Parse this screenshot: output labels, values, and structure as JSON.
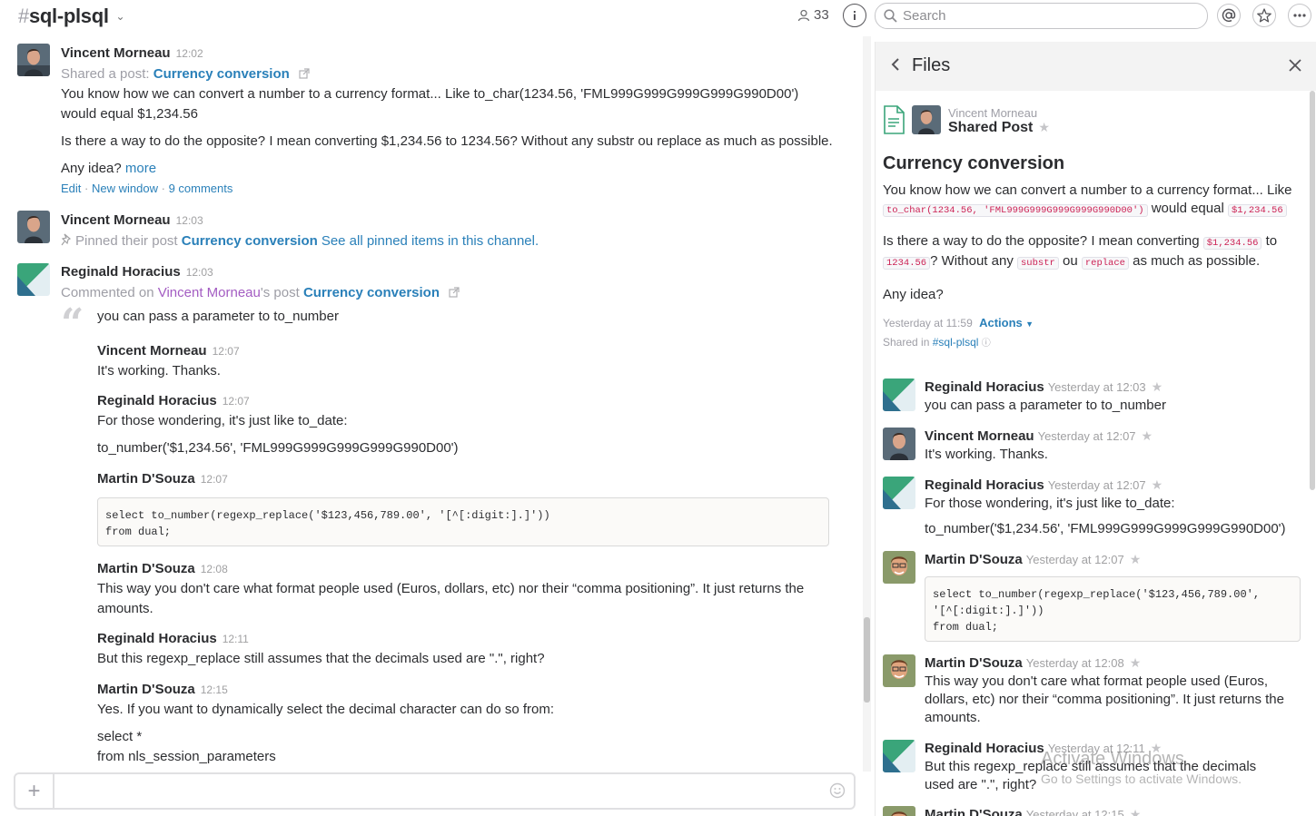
{
  "header": {
    "hash": "#",
    "channel": "sql-plsql",
    "member_count": "33",
    "search_placeholder": "Search"
  },
  "messages": {
    "m1": {
      "author": "Vincent Morneau",
      "time": "12:02",
      "shared_prefix": "Shared a post:",
      "post_title": "Currency conversion",
      "p1": "You know how we can convert a number to a currency format... Like to_char(1234.56, 'FML999G999G999G999G990D00') would equal $1,234.56",
      "p2": "Is there a way to do the opposite? I mean converting $1,234.56 to 1234.56? Without any substr ou replace as much as possible.",
      "p3": "Any idea?",
      "more": "more",
      "edit": "Edit",
      "new_window": "New window",
      "comments": "9 comments"
    },
    "m2": {
      "author": "Vincent Morneau",
      "time": "12:03",
      "pinned_prefix": "Pinned their post",
      "post_title": "Currency conversion",
      "see_all": "See all pinned items in this channel."
    },
    "m3": {
      "author": "Reginald Horacius",
      "time": "12:03",
      "commented_on": "Commented on",
      "owner": "Vincent Morneau",
      "owner_suffix": "'s post",
      "post_title": "Currency conversion",
      "quote": "you can pass a parameter to to_number"
    },
    "replies": [
      {
        "author": "Vincent Morneau",
        "time": "12:07",
        "text": "It's working. Thanks."
      },
      {
        "author": "Reginald Horacius",
        "time": "12:07",
        "text": "For those wondering, it's just like to_date:",
        "text2": "to_number('$1,234.56', 'FML999G999G999G999G990D00')"
      },
      {
        "author": "Martin D'Souza",
        "time": "12:07",
        "code1": "select to_number(regexp_replace('$123,456,789.00', '[^[:digit:].]'))",
        "code2": "from dual;"
      },
      {
        "author": "Martin D'Souza",
        "time": "12:08",
        "text": "This way you don't care what format people used (Euros, dollars, etc) nor their “comma positioning”. It just returns the amounts."
      },
      {
        "author": "Reginald Horacius",
        "time": "12:11",
        "text": "But this regexp_replace still assumes that the decimals used are \".\", right?"
      },
      {
        "author": "Martin D'Souza",
        "time": "12:15",
        "text": "Yes. If you want to dynamically select the decimal character can do so from:",
        "text2": "select *",
        "text3": "from nls_session_parameters"
      }
    ]
  },
  "composer": {
    "plus": "+",
    "placeholder": ""
  },
  "files": {
    "title": "Files",
    "post_author": "Vincent Morneau",
    "post_type": "Shared Post",
    "post_title": "Currency conversion",
    "b1_a": "You know how we can convert a number to a currency format... Like",
    "b1_code": "to_char(1234.56, 'FML999G999G999G999G990D00')",
    "b1_b": "would equal",
    "b1_code2": "$1,234.56",
    "b2_a": "Is there a way to do the opposite? I mean converting",
    "b2_code": "$1,234.56",
    "b2_b": "to",
    "b2_code2": "1234.56",
    "b2_c": "? Without any",
    "b2_code3": "substr",
    "b2_d": "ou",
    "b2_code4": "replace",
    "b2_e": "as much as possible.",
    "b3": "Any idea?",
    "meta_time": "Yesterday at 11:59",
    "actions": "Actions",
    "shared_in": "Shared in",
    "shared_channel": "#sql-plsql",
    "comments": [
      {
        "author": "Reginald Horacius",
        "time": "Yesterday at 12:03",
        "text": "you can pass a parameter to to_number"
      },
      {
        "author": "Vincent Morneau",
        "time": "Yesterday at 12:07",
        "text": "It's working. Thanks."
      },
      {
        "author": "Reginald Horacius",
        "time": "Yesterday at 12:07",
        "text": "For those wondering, it's just like to_date:",
        "text2": "to_number('$1,234.56', 'FML999G999G999G999G990D00')"
      },
      {
        "author": "Martin D'Souza",
        "time": "Yesterday at 12:07",
        "code1": "select to_number(regexp_replace('$123,456,789.00',",
        "code2": "'[^[:digit:].]'))",
        "code3": "from dual;"
      },
      {
        "author": "Martin D'Souza",
        "time": "Yesterday at 12:08",
        "text": "This way you don't care what format people used (Euros, dollars, etc) nor their “comma positioning”. It just returns the amounts."
      },
      {
        "author": "Reginald Horacius",
        "time": "Yesterday at 12:11",
        "text": "But this regexp_replace still assumes that the decimals used are \".\", right?"
      },
      {
        "author": "Martin D'Souza",
        "time": "Yesterday at 12:15"
      }
    ]
  },
  "watermark": {
    "line1": "Activate Windows",
    "line2": "Go to Settings to activate Windows."
  }
}
